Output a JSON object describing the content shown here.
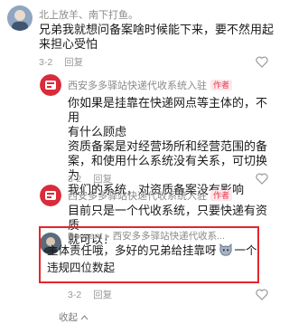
{
  "comments": [
    {
      "user": "北上放羊、南下打鱼。",
      "lines": [
        "兄弟我就想问备案啥时候能下来，要不然用起",
        "来担心受怕"
      ],
      "date": "3-2",
      "reply_label": "回复"
    },
    {
      "user": "西安多多驿站快递代收系统入驻",
      "badge": "作者",
      "lines": [
        "你如果是挂靠在快递网点等主体的，不用",
        "有什么顾虑",
        "资质备案是对经营场所和经营范围的备",
        "案，和使用什么系统没有关系，可切换为",
        "我们的系统，对资质备案没有影响"
      ],
      "date": "3-2",
      "reply_label": "回复"
    },
    {
      "user": "西安多多驿站快递代收系统入驻",
      "badge": "作者",
      "lines": [
        "目前只是一个代收系统，只要快递有资质",
        "就可以！"
      ],
      "date": "3-2",
      "reply_label": "回复"
    },
    {
      "user": "Buoyant",
      "reply_arrow": "▸",
      "reply_to": "西安多多驿站快递代收系...",
      "lines": [
        "主体责任哦，多好的兄弟给挂靠呀",
        "一个",
        "违规四位数起"
      ],
      "date": "3-2",
      "reply_label": "回复"
    }
  ],
  "collapse_label": "收起",
  "colors": {
    "highlight_border": "#e4262b",
    "author_badge": "#e8344e",
    "meta": "#9a9a9a"
  },
  "icons": [
    "user-avatar",
    "brand-avatar",
    "heart-icon",
    "cat-emoji-icon",
    "chevron-up-icon"
  ]
}
